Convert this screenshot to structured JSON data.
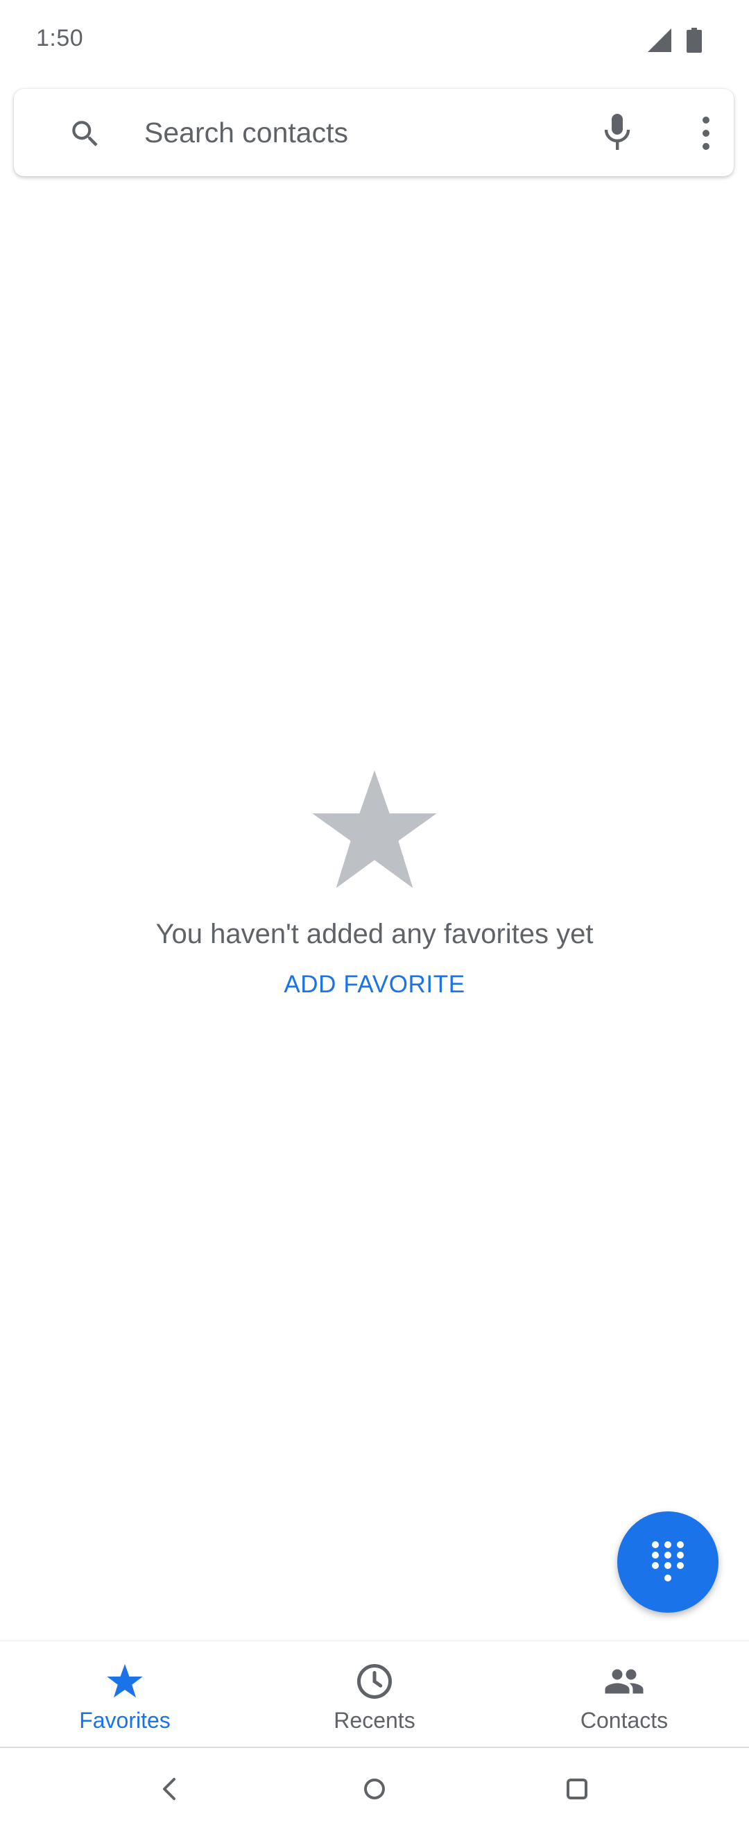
{
  "status_bar": {
    "time": "1:50",
    "icons": [
      "signal-icon",
      "battery-icon"
    ]
  },
  "search": {
    "placeholder": "Search contacts",
    "value": "",
    "icons": [
      "search-icon",
      "mic-icon",
      "more-vert-icon"
    ]
  },
  "empty_state": {
    "icon": "star-icon",
    "message": "You haven't added any favorites yet",
    "action_label": "ADD FAVORITE"
  },
  "fab": {
    "icon": "dialpad-icon"
  },
  "bottom_nav": {
    "items": [
      {
        "label": "Favorites",
        "icon": "star-icon",
        "active": true
      },
      {
        "label": "Recents",
        "icon": "clock-icon",
        "active": false
      },
      {
        "label": "Contacts",
        "icon": "people-icon",
        "active": false
      }
    ]
  },
  "system_nav": {
    "icons": [
      "back-icon",
      "home-icon",
      "recents-icon"
    ]
  },
  "colors": {
    "accent": "#1a73e8",
    "text_secondary": "#5f6368",
    "icon_gray": "#5f6368",
    "empty_star": "#bdc1c6"
  }
}
